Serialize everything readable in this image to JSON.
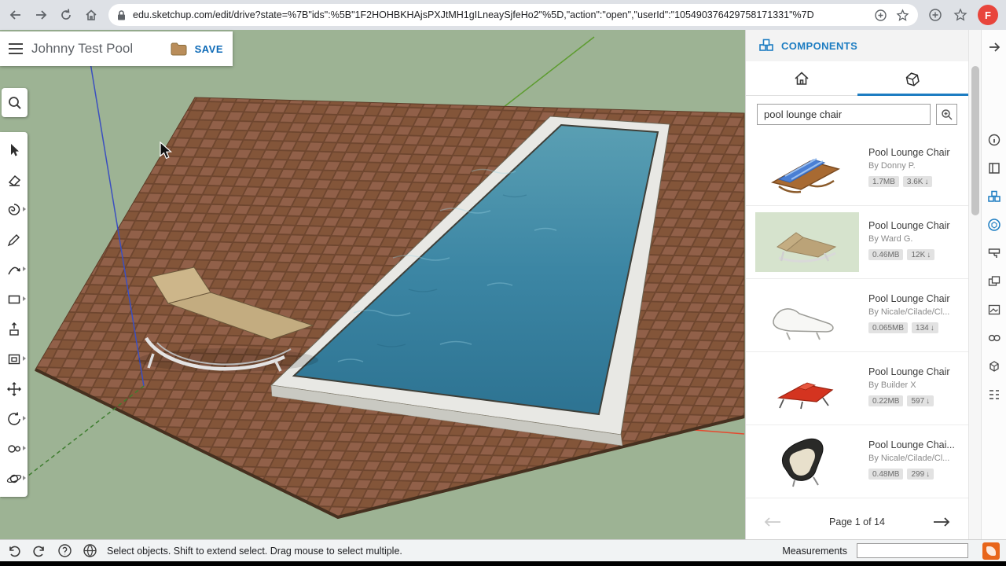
{
  "browser": {
    "url": "edu.sketchup.com/edit/drive?state=%7B\"ids\":%5B\"1F2HOHBKHAjsPXJtMH1gILneaySjfeHo2\"%5D,\"action\":\"open\",\"userId\":\"105490376429758171331\"%7D",
    "avatar_initial": "F"
  },
  "header": {
    "title": "Johnny Test Pool",
    "save_label": "SAVE"
  },
  "left_toolbar": {
    "tools": [
      "select",
      "eraser",
      "paint",
      "line",
      "arc",
      "rectangle",
      "push-pull",
      "offset",
      "move",
      "rotate",
      "tape-measure",
      "orbit"
    ]
  },
  "panel": {
    "title": "COMPONENTS",
    "tabs": [
      "home",
      "3d-warehouse"
    ],
    "search": {
      "value": "pool lounge chair"
    },
    "download_arrow": "↓",
    "results": [
      {
        "title": "Pool Lounge Chair",
        "author": "By Donny P.",
        "size": "1.7MB",
        "downloads": "3.6K"
      },
      {
        "title": "Pool Lounge Chair",
        "author": "By Ward G.",
        "size": "0.46MB",
        "downloads": "12K"
      },
      {
        "title": "Pool Lounge Chair",
        "author": "By Nicale/Cilade/Cl...",
        "size": "0.065MB",
        "downloads": "134"
      },
      {
        "title": "Pool Lounge Chair",
        "author": "By Builder X",
        "size": "0.22MB",
        "downloads": "597"
      },
      {
        "title": "Pool Lounge Chai...",
        "author": "By Nicale/Cilade/Cl...",
        "size": "0.48MB",
        "downloads": "299"
      }
    ],
    "pagination": "Page 1 of 14"
  },
  "right_rail": {
    "icons": [
      "entity-info",
      "instructor",
      "components",
      "3d-warehouse",
      "materials",
      "styles",
      "scenes",
      "soften-edges",
      "views",
      "outliner"
    ]
  },
  "status_bar": {
    "hint": "Select objects. Shift to extend select. Drag mouse to select multiple.",
    "measurements_label": "Measurements"
  },
  "colors": {
    "accent_blue": "#1d7dc2",
    "save_blue": "#0d6ab7",
    "avatar_red": "#e8453c",
    "canvas_green": "#9db394",
    "deck_brown": "#8a5a40",
    "water_blue": "#3c86a4",
    "axis_red": "#e5492f",
    "axis_green": "#5d9c30",
    "axis_blue": "#3b4fc0"
  }
}
